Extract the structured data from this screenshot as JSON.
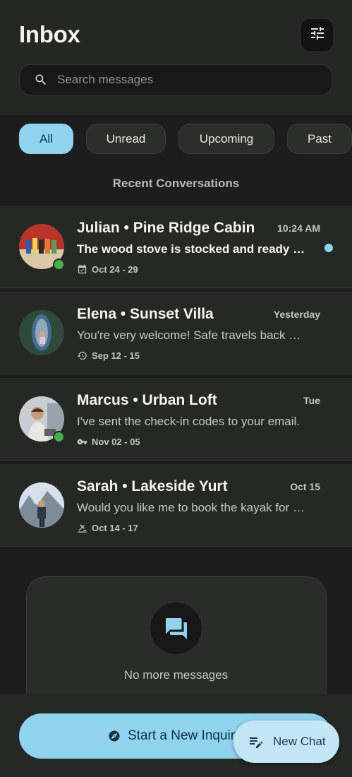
{
  "header": {
    "title": "Inbox",
    "filter_icon": "tune-icon",
    "search": {
      "placeholder": "Search messages",
      "value": "",
      "icon": "search-icon"
    }
  },
  "filters": [
    {
      "label": "All",
      "active": true
    },
    {
      "label": "Unread",
      "active": false
    },
    {
      "label": "Upcoming",
      "active": false
    },
    {
      "label": "Past",
      "active": false
    }
  ],
  "section_label": "Recent Conversations",
  "conversations": [
    {
      "name": "Julian • Pine Ridge Cabin",
      "time": "10:24 AM",
      "preview": "The wood stove is stocked and ready fo...",
      "dates": "Oct 24 - 29",
      "date_icon": "calendar-check-icon",
      "unread": true,
      "online": true
    },
    {
      "name": "Elena • Sunset Villa",
      "time": "Yesterday",
      "preview": "You're very welcome! Safe travels back ho...",
      "dates": "Sep 12 - 15",
      "date_icon": "history-icon",
      "unread": false,
      "online": false
    },
    {
      "name": "Marcus • Urban Loft",
      "time": "Tue",
      "preview": "I've sent the check-in codes to your email.",
      "dates": "Nov 02 - 05",
      "date_icon": "key-icon",
      "unread": false,
      "online": true
    },
    {
      "name": "Sarah • Lakeside Yurt",
      "time": "Oct 15",
      "preview": "Would you like me to book the kayak for Fr...",
      "dates": "Oct 14 - 17",
      "date_icon": "kayak-icon",
      "unread": false,
      "online": false
    }
  ],
  "empty_state": {
    "text": "No more messages",
    "icon": "forum-icon"
  },
  "cta": {
    "label": "Start a New Inquiry",
    "icon": "compass-icon"
  },
  "fab": {
    "label": "New Chat",
    "icon": "edit-note-icon"
  },
  "colors": {
    "accent": "#8fd3ef",
    "online": "#43b34a",
    "background": "#1c1d1c",
    "surface": "#262826"
  }
}
